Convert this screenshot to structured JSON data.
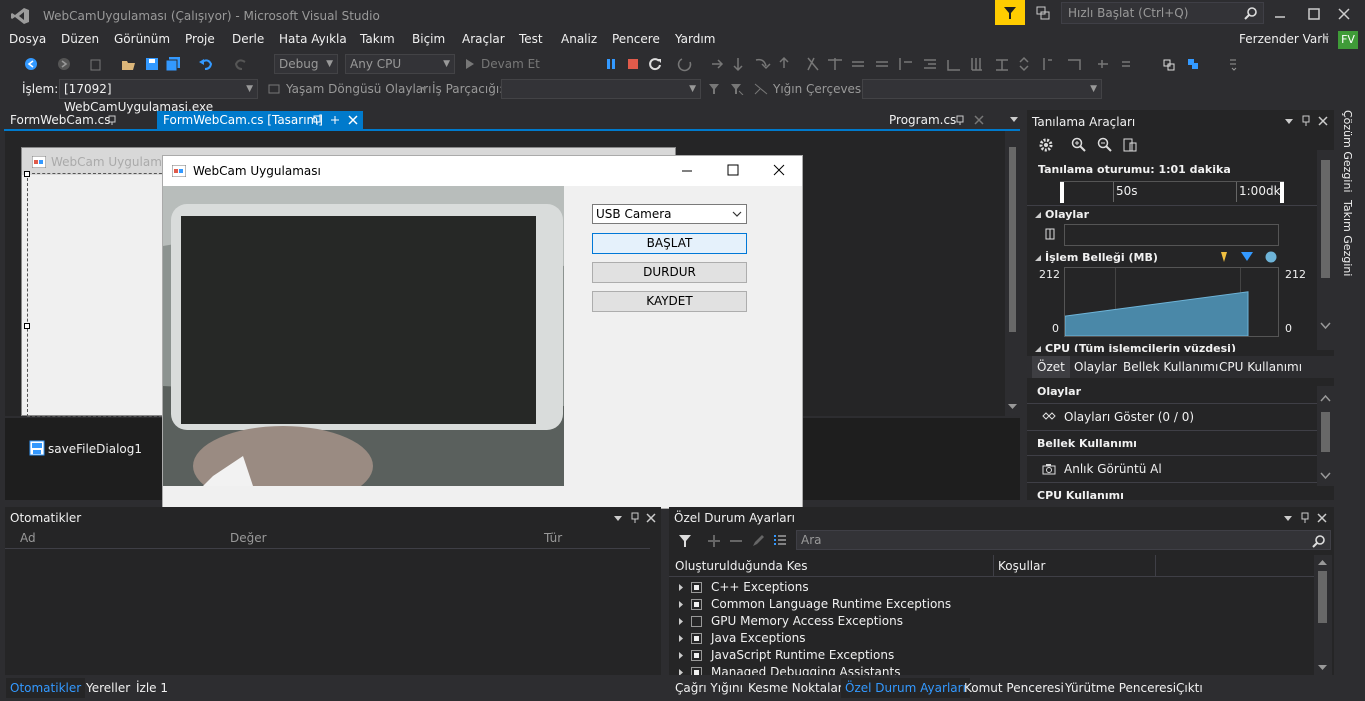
{
  "titlebar": {
    "title": "WebCamUygulaması (Çalışıyor) - Microsoft Visual Studio",
    "quick_launch_placeholder": "Hızlı Başlat (Ctrl+Q)"
  },
  "menu": [
    "Dosya",
    "Düzen",
    "Görünüm",
    "Proje",
    "Derle",
    "Hata Ayıkla",
    "Takım",
    "Biçim",
    "Araçlar",
    "Test",
    "Analiz",
    "Pencere",
    "Yardım"
  ],
  "user": {
    "name": "Ferzender Varli",
    "initials": "FV"
  },
  "toolbar": {
    "config": "Debug",
    "platform": "Any CPU",
    "continue": "Devam Et"
  },
  "debugbar": {
    "process_label": "İşlem:",
    "process_value": "[17092] WebCamUygulamasi.exe",
    "lifecycle": "Yaşam Döngüsü Olayları",
    "thread_label": "İş Parçacığı:",
    "stack_label": "Yığın Çerçevesi:"
  },
  "doc_tabs": {
    "tab1": "FormWebCam.cs",
    "tab2": "FormWebCam.cs [Tasarım]",
    "tab3": "Program.cs"
  },
  "designer": {
    "form_title": "WebCam Uygulaması",
    "component": "saveFileDialog1"
  },
  "app_window": {
    "title": "WebCam Uygulaması",
    "camera_select": "USB Camera",
    "start_button": "BAŞLAT",
    "stop_button": "DURDUR",
    "save_button": "KAYDET"
  },
  "diag": {
    "title": "Tanılama Araçları",
    "session": "Tanılama oturumu: 1:01 dakika",
    "t50": "50s",
    "t100": "1:00dk",
    "events_section": "Olaylar",
    "memory_section": "İşlem Belleği (MB)",
    "mem_max_l": "212",
    "mem_min_l": "0",
    "mem_max_r": "212",
    "mem_min_r": "0",
    "cpu_section": "CPU (Tüm işlemcilerin yüzdesi)",
    "tabs": [
      "Özet",
      "Olaylar",
      "Bellek Kullanımı",
      "CPU Kullanımı"
    ],
    "summary_events": "Olaylar",
    "show_events": "Olayları Göster (0 / 0)",
    "summary_memory": "Bellek Kullanımı",
    "snapshot": "Anlık Görüntü Al",
    "summary_cpu": "CPU Kullanımı",
    "memory_level": 0.65
  },
  "side_tabs": {
    "solution": "Çözüm Gezgini",
    "team": "Takım Gezgini"
  },
  "autos": {
    "title": "Otomatikler",
    "col_name": "Ad",
    "col_value": "Değer",
    "col_type": "Tür",
    "tabs": [
      "Otomatikler",
      "Yereller",
      "İzle 1"
    ]
  },
  "exceptions": {
    "title": "Özel Durum Ayarları",
    "search_placeholder": "Ara",
    "col_break": "Oluşturulduğunda Kes",
    "col_conditions": "Koşullar",
    "rows": [
      {
        "label": "C++ Exceptions",
        "checked": true
      },
      {
        "label": "Common Language Runtime Exceptions",
        "checked": true
      },
      {
        "label": "GPU Memory Access Exceptions",
        "checked": false
      },
      {
        "label": "Java Exceptions",
        "checked": true
      },
      {
        "label": "JavaScript Runtime Exceptions",
        "checked": true
      },
      {
        "label": "Managed Debugging Assistants",
        "checked": true
      }
    ],
    "tabs": [
      "Çağrı Yığını",
      "Kesme Noktaları",
      "Özel Durum Ayarları",
      "Komut Penceresi",
      "Yürütme Penceresi",
      "Çıktı"
    ]
  },
  "colors": {
    "accent": "#007acc",
    "bg": "#2d2d30",
    "panel": "#252526",
    "user_badge": "#3f9b38",
    "notify": "#ffcc00"
  }
}
